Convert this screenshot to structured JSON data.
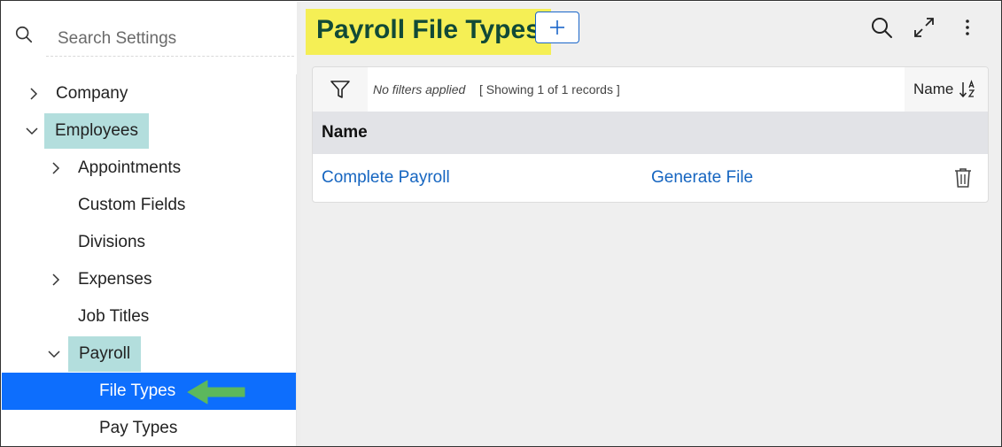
{
  "search": {
    "placeholder": "Search Settings"
  },
  "sidebar": {
    "items": [
      {
        "label": "Company"
      },
      {
        "label": "Employees"
      },
      {
        "label": "Appointments"
      },
      {
        "label": "Custom Fields"
      },
      {
        "label": "Divisions"
      },
      {
        "label": "Expenses"
      },
      {
        "label": "Job Titles"
      },
      {
        "label": "Payroll"
      },
      {
        "label": "File Types"
      },
      {
        "label": "Pay Types"
      }
    ]
  },
  "main": {
    "title": "Payroll File Types",
    "toolbar": {
      "filter_status": "No filters applied",
      "record_count": "[ Showing 1 of 1 records ]",
      "sort_label": "Name"
    },
    "table": {
      "column_header": "Name",
      "rows": [
        {
          "name": "Complete Payroll",
          "action": "Generate File"
        }
      ]
    }
  },
  "colors": {
    "selected_bg": "#0d6efd",
    "highlight_bg": "#b3dedd",
    "title_bg": "#f5ef55",
    "title_text": "#114a37",
    "link": "#1565c0",
    "arrow": "#5cb85c"
  }
}
